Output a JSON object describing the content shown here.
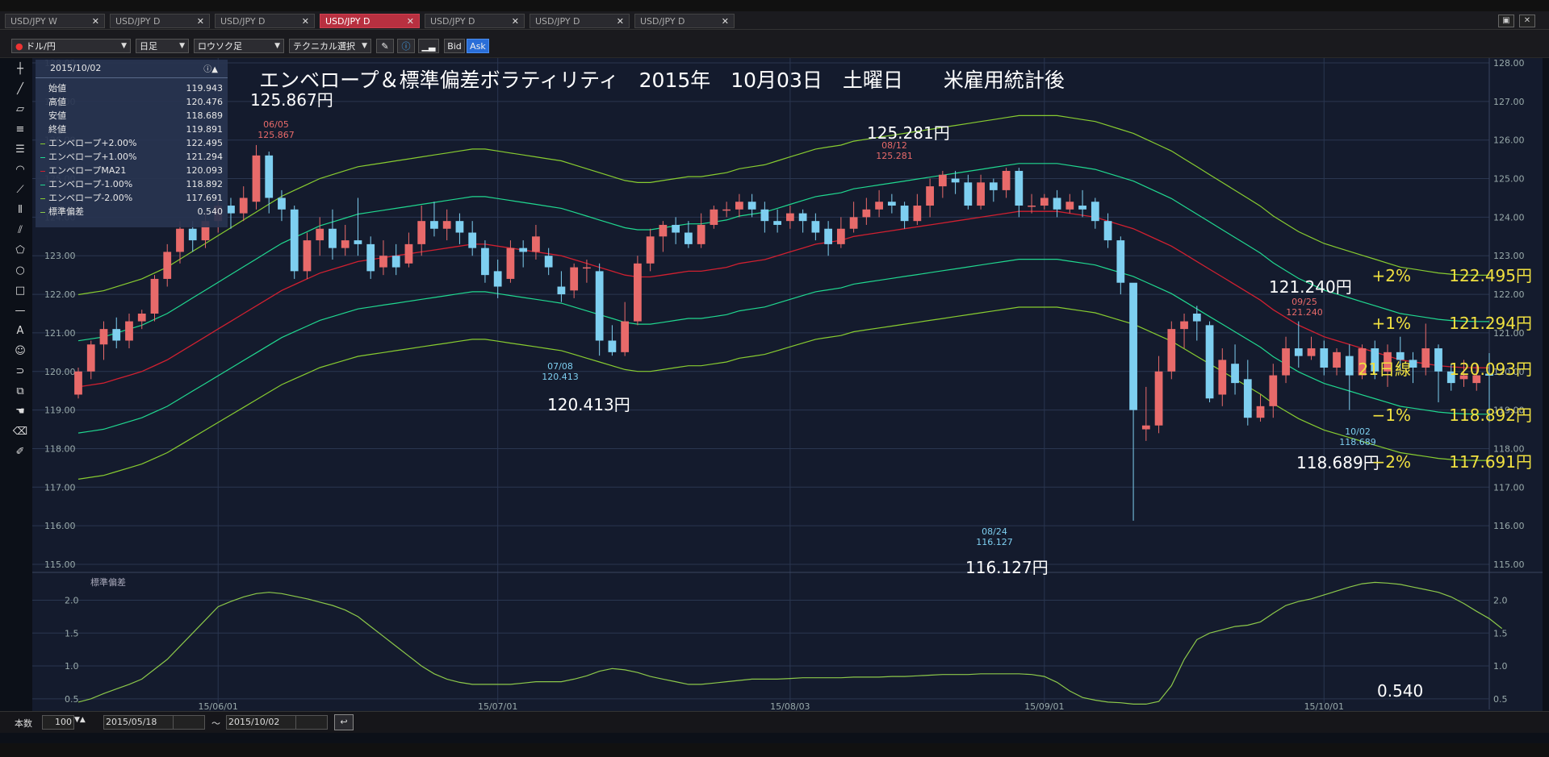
{
  "tabs": [
    "USD/JPY W",
    "USD/JPY D",
    "USD/JPY D",
    "USD/JPY D",
    "USD/JPY D",
    "USD/JPY D",
    "USD/JPY D"
  ],
  "active_tab_index": 3,
  "toolbar": {
    "currency": "ドル/円",
    "period": "日足",
    "chart_style": "ロウソク足",
    "technical": "テクニカル選択",
    "bid_label": "Bid",
    "ask_label": "Ask"
  },
  "infobox": {
    "date": "2015/10/02",
    "rows": [
      {
        "label": "始値",
        "value": "119.943"
      },
      {
        "label": "高値",
        "value": "120.476"
      },
      {
        "label": "安値",
        "value": "118.689"
      },
      {
        "label": "終値",
        "value": "119.891"
      },
      {
        "label": "エンベロープ+2.00%",
        "value": "122.495"
      },
      {
        "label": "エンベロープ+1.00%",
        "value": "121.294"
      },
      {
        "label": "エンベロープMA21",
        "value": "120.093"
      },
      {
        "label": "エンベロープ-1.00%",
        "value": "118.892"
      },
      {
        "label": "エンベロープ-2.00%",
        "value": "117.691"
      },
      {
        "label": "標準偏差",
        "value": "0.540"
      }
    ]
  },
  "bottombar": {
    "count_label": "本数",
    "count_value": "100",
    "from_date": "2015/05/18",
    "tilde": "〜",
    "to_date": "2015/10/02"
  },
  "colors": {
    "bg": "#141b2d",
    "up": "#e86a6a",
    "down": "#7ecff0",
    "ma": "#d02030",
    "env1": "#20d890",
    "env2": "#88cc30",
    "sd": "#8cc84a",
    "grid": "#2a3650",
    "yellow": "#f0e040"
  },
  "chart_data": {
    "type": "candlestick",
    "title": "エンベロープ＆標準偏差ボラティリティ　2015年　10月03日　土曜日　　米雇用統計後",
    "y_ticks": [
      "128.00",
      "127.00",
      "126.00",
      "125.00",
      "124.00",
      "123.00",
      "122.00",
      "121.00",
      "120.00",
      "119.00",
      "118.00",
      "117.00",
      "116.00",
      "115.00"
    ],
    "ylim": [
      115,
      128
    ],
    "x_ticks": [
      {
        "label": "15/06/01",
        "index": 11
      },
      {
        "label": "15/07/01",
        "index": 33
      },
      {
        "label": "15/08/03",
        "index": 56
      },
      {
        "label": "15/09/01",
        "index": 76
      },
      {
        "label": "15/10/01",
        "index": 98
      }
    ],
    "candles": [
      [
        119.4,
        120.0,
        119.3,
        120.1
      ],
      [
        120.0,
        120.7,
        119.8,
        120.8
      ],
      [
        120.7,
        121.1,
        120.3,
        121.3
      ],
      [
        121.1,
        120.8,
        120.6,
        121.4
      ],
      [
        120.8,
        121.3,
        120.6,
        121.5
      ],
      [
        121.3,
        121.5,
        121.1,
        121.6
      ],
      [
        121.5,
        122.4,
        121.3,
        122.5
      ],
      [
        122.4,
        123.1,
        122.2,
        123.3
      ],
      [
        123.1,
        123.7,
        122.8,
        123.9
      ],
      [
        123.7,
        123.4,
        123.1,
        123.9
      ],
      [
        123.4,
        123.9,
        123.2,
        124.1
      ],
      [
        123.9,
        124.3,
        123.6,
        124.5
      ],
      [
        124.3,
        124.1,
        123.7,
        124.5
      ],
      [
        124.1,
        124.5,
        123.9,
        124.8
      ],
      [
        124.4,
        125.6,
        124.2,
        125.87
      ],
      [
        125.6,
        124.5,
        124.1,
        125.7
      ],
      [
        124.5,
        124.2,
        123.9,
        124.7
      ],
      [
        124.2,
        122.6,
        122.4,
        124.3
      ],
      [
        122.6,
        123.4,
        122.4,
        123.6
      ],
      [
        123.4,
        123.7,
        123.0,
        124.0
      ],
      [
        123.7,
        123.2,
        122.9,
        124.2
      ],
      [
        123.2,
        123.4,
        123.0,
        123.8
      ],
      [
        123.4,
        123.3,
        123.0,
        124.5
      ],
      [
        123.3,
        122.6,
        122.4,
        123.5
      ],
      [
        122.7,
        123.0,
        122.5,
        123.4
      ],
      [
        123.0,
        122.7,
        122.5,
        123.3
      ],
      [
        122.8,
        123.3,
        122.7,
        123.6
      ],
      [
        123.3,
        123.9,
        123.0,
        124.3
      ],
      [
        123.9,
        123.7,
        123.5,
        124.4
      ],
      [
        123.7,
        123.9,
        123.4,
        124.2
      ],
      [
        123.9,
        123.6,
        123.3,
        124.1
      ],
      [
        123.6,
        123.2,
        123.0,
        123.9
      ],
      [
        123.2,
        122.5,
        122.3,
        123.4
      ],
      [
        122.6,
        122.2,
        121.9,
        122.9
      ],
      [
        122.4,
        123.2,
        122.3,
        123.4
      ],
      [
        123.2,
        123.1,
        122.7,
        123.4
      ],
      [
        123.1,
        123.5,
        122.9,
        123.8
      ],
      [
        123.0,
        122.7,
        122.5,
        123.2
      ],
      [
        122.2,
        122.0,
        121.8,
        122.6
      ],
      [
        122.1,
        122.7,
        121.9,
        122.8
      ],
      [
        122.7,
        122.7,
        122.3,
        122.9
      ],
      [
        122.6,
        120.8,
        120.41,
        122.8
      ],
      [
        120.8,
        120.5,
        120.41,
        121.2
      ],
      [
        120.5,
        121.3,
        120.4,
        121.8
      ],
      [
        121.3,
        122.8,
        121.2,
        123.0
      ],
      [
        122.8,
        123.5,
        122.6,
        123.7
      ],
      [
        123.5,
        123.8,
        123.1,
        123.9
      ],
      [
        123.8,
        123.6,
        123.3,
        124.0
      ],
      [
        123.6,
        123.3,
        123.2,
        123.9
      ],
      [
        123.3,
        123.8,
        123.2,
        124.1
      ],
      [
        123.8,
        124.2,
        123.7,
        124.3
      ],
      [
        124.2,
        124.2,
        124.0,
        124.4
      ],
      [
        124.2,
        124.4,
        124.0,
        124.6
      ],
      [
        124.4,
        124.2,
        124.0,
        124.6
      ],
      [
        124.2,
        123.9,
        123.6,
        124.4
      ],
      [
        123.9,
        123.8,
        123.6,
        124.2
      ],
      [
        123.9,
        124.1,
        123.7,
        124.3
      ],
      [
        124.1,
        123.9,
        123.6,
        124.2
      ],
      [
        123.9,
        123.6,
        123.4,
        124.1
      ],
      [
        123.7,
        123.3,
        123.0,
        123.9
      ],
      [
        123.3,
        123.7,
        123.2,
        124.0
      ],
      [
        123.7,
        124.0,
        123.6,
        124.4
      ],
      [
        124.0,
        124.2,
        123.8,
        124.5
      ],
      [
        124.2,
        124.4,
        124.0,
        124.7
      ],
      [
        124.4,
        124.3,
        124.1,
        124.6
      ],
      [
        124.3,
        123.9,
        123.7,
        124.4
      ],
      [
        123.9,
        124.3,
        123.8,
        124.6
      ],
      [
        124.3,
        124.8,
        124.0,
        125.0
      ],
      [
        124.8,
        125.1,
        124.5,
        125.2
      ],
      [
        125.0,
        124.9,
        124.6,
        125.2
      ],
      [
        124.9,
        124.3,
        124.2,
        125.1
      ],
      [
        124.3,
        124.9,
        124.2,
        125.1
      ],
      [
        124.9,
        124.7,
        124.4,
        125.0
      ],
      [
        124.7,
        125.2,
        124.5,
        125.28
      ],
      [
        125.2,
        124.3,
        124.0,
        125.28
      ],
      [
        124.3,
        124.3,
        124.1,
        124.6
      ],
      [
        124.3,
        124.5,
        124.2,
        124.6
      ],
      [
        124.5,
        124.2,
        124.0,
        124.7
      ],
      [
        124.2,
        124.4,
        124.1,
        124.6
      ],
      [
        124.3,
        124.2,
        124.0,
        124.7
      ],
      [
        124.4,
        123.9,
        123.7,
        124.5
      ],
      [
        123.9,
        123.4,
        123.2,
        124.1
      ],
      [
        123.4,
        122.3,
        122.0,
        123.5
      ],
      [
        122.3,
        119.0,
        116.13,
        122.2
      ],
      [
        118.5,
        118.6,
        118.2,
        119.6
      ],
      [
        118.6,
        120.0,
        118.4,
        120.4
      ],
      [
        120.0,
        121.1,
        119.8,
        121.3
      ],
      [
        121.1,
        121.3,
        120.6,
        121.5
      ],
      [
        121.5,
        121.3,
        120.8,
        121.7
      ],
      [
        121.2,
        119.3,
        119.2,
        121.3
      ],
      [
        119.4,
        120.3,
        119.1,
        120.6
      ],
      [
        120.2,
        119.7,
        119.4,
        120.7
      ],
      [
        119.8,
        118.8,
        118.6,
        120.3
      ],
      [
        118.8,
        119.1,
        118.7,
        119.4
      ],
      [
        119.1,
        119.9,
        118.8,
        120.2
      ],
      [
        119.9,
        120.6,
        119.7,
        120.9
      ],
      [
        120.6,
        120.4,
        120.1,
        121.3
      ],
      [
        120.4,
        120.6,
        120.3,
        120.9
      ],
      [
        120.6,
        120.1,
        119.9,
        120.8
      ],
      [
        120.1,
        120.5,
        119.9,
        120.6
      ],
      [
        120.4,
        119.9,
        119.0,
        120.7
      ],
      [
        119.9,
        120.6,
        119.8,
        120.7
      ],
      [
        120.6,
        120.0,
        119.8,
        120.8
      ],
      [
        120.0,
        120.5,
        119.6,
        120.7
      ],
      [
        120.5,
        120.3,
        120.0,
        120.9
      ],
      [
        120.3,
        120.1,
        119.7,
        120.5
      ],
      [
        120.1,
        120.6,
        119.9,
        121.24
      ],
      [
        120.6,
        120.0,
        119.2,
        120.7
      ],
      [
        120.0,
        119.7,
        119.5,
        120.2
      ],
      [
        119.8,
        119.9,
        119.6,
        120.3
      ],
      [
        119.7,
        119.9,
        119.5,
        120.2
      ],
      [
        119.943,
        119.891,
        118.689,
        120.476
      ]
    ],
    "ma21": [
      119.6,
      119.65,
      119.7,
      119.8,
      119.9,
      120.0,
      120.15,
      120.3,
      120.5,
      120.7,
      120.9,
      121.1,
      121.3,
      121.5,
      121.7,
      121.9,
      122.1,
      122.25,
      122.4,
      122.55,
      122.65,
      122.75,
      122.85,
      122.9,
      122.95,
      123.0,
      123.05,
      123.1,
      123.15,
      123.2,
      123.25,
      123.3,
      123.3,
      123.25,
      123.2,
      123.15,
      123.1,
      123.05,
      123.0,
      122.9,
      122.8,
      122.7,
      122.6,
      122.5,
      122.45,
      122.45,
      122.5,
      122.55,
      122.6,
      122.6,
      122.65,
      122.7,
      122.8,
      122.85,
      122.9,
      123.0,
      123.1,
      123.2,
      123.3,
      123.35,
      123.4,
      123.5,
      123.55,
      123.6,
      123.65,
      123.7,
      123.75,
      123.8,
      123.85,
      123.9,
      123.95,
      124.0,
      124.05,
      124.1,
      124.15,
      124.15,
      124.15,
      124.15,
      124.1,
      124.05,
      124.0,
      123.9,
      123.8,
      123.7,
      123.55,
      123.4,
      123.25,
      123.05,
      122.85,
      122.65,
      122.45,
      122.25,
      122.05,
      121.85,
      121.6,
      121.4,
      121.2,
      121.05,
      120.9,
      120.8,
      120.7,
      120.6,
      120.5,
      120.4,
      120.3,
      120.25,
      120.2,
      120.15,
      120.12,
      120.1,
      120.095,
      120.093
    ],
    "env_pct": [
      2,
      1,
      -1,
      -2
    ],
    "sd_ticks": [
      "2.0",
      "1.5",
      "1.0",
      "0.5"
    ],
    "sd_ylim": [
      0.4,
      2.3
    ],
    "sd_series": [
      0.45,
      0.5,
      0.58,
      0.65,
      0.72,
      0.8,
      0.95,
      1.1,
      1.3,
      1.5,
      1.7,
      1.9,
      1.98,
      2.05,
      2.1,
      2.12,
      2.1,
      2.06,
      2.02,
      1.97,
      1.92,
      1.85,
      1.75,
      1.6,
      1.45,
      1.3,
      1.15,
      1.0,
      0.88,
      0.8,
      0.75,
      0.72,
      0.72,
      0.72,
      0.72,
      0.74,
      0.76,
      0.76,
      0.76,
      0.8,
      0.85,
      0.92,
      0.96,
      0.94,
      0.9,
      0.84,
      0.8,
      0.76,
      0.72,
      0.72,
      0.74,
      0.76,
      0.78,
      0.8,
      0.8,
      0.8,
      0.81,
      0.82,
      0.82,
      0.82,
      0.82,
      0.83,
      0.83,
      0.83,
      0.84,
      0.84,
      0.85,
      0.86,
      0.87,
      0.87,
      0.87,
      0.88,
      0.88,
      0.88,
      0.88,
      0.87,
      0.84,
      0.75,
      0.62,
      0.52,
      0.48,
      0.45,
      0.44,
      0.42,
      0.42,
      0.46,
      0.7,
      1.1,
      1.4,
      1.5,
      1.55,
      1.6,
      1.62,
      1.67,
      1.8,
      1.92,
      1.98,
      2.02,
      2.08,
      2.14,
      2.2,
      2.25,
      2.27,
      2.26,
      2.24,
      2.2,
      2.16,
      2.12,
      2.05,
      1.95,
      1.83,
      1.72,
      1.57
    ],
    "sd_label": "標準偏差",
    "sd_value": "0.540",
    "annotations": {
      "high1": {
        "big": "125.867円",
        "date": "06/05",
        "val": "125.867"
      },
      "low1": {
        "big": "120.413円",
        "date": "07/08",
        "val": "120.413"
      },
      "high2": {
        "big": "125.281円",
        "date": "08/12",
        "val": "125.281"
      },
      "low2": {
        "big": "116.127円",
        "date": "08/24",
        "val": "116.127"
      },
      "high3": {
        "big": "121.240円",
        "date": "09/25",
        "val": "121.240"
      },
      "low3": {
        "big": "118.689円",
        "date": "10/02",
        "val": "118.689"
      }
    },
    "right_labels": [
      {
        "name": "+2%",
        "value": "122.495円"
      },
      {
        "name": "+1%",
        "value": "121.294円"
      },
      {
        "name": "21日線",
        "value": "120.093円"
      },
      {
        "name": "−1%",
        "value": "118.892円"
      },
      {
        "name": "−2%",
        "value": "117.691円"
      }
    ]
  }
}
